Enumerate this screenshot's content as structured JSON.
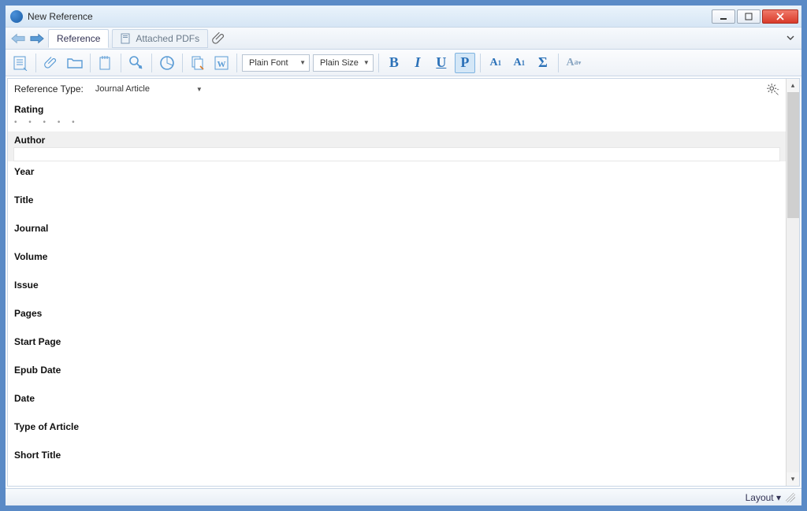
{
  "window": {
    "title": "New Reference"
  },
  "tabs": {
    "reference": "Reference",
    "attached": "Attached PDFs"
  },
  "toolbar": {
    "font": "Plain Font",
    "size": "Plain Size"
  },
  "reftype": {
    "label": "Reference Type:",
    "value": "Journal Article"
  },
  "fields": [
    "Rating",
    "Author",
    "Year",
    "Title",
    "Journal",
    "Volume",
    "Issue",
    "Pages",
    "Start Page",
    "Epub Date",
    "Date",
    "Type of Article",
    "Short Title"
  ],
  "status": {
    "layout": "Layout"
  }
}
